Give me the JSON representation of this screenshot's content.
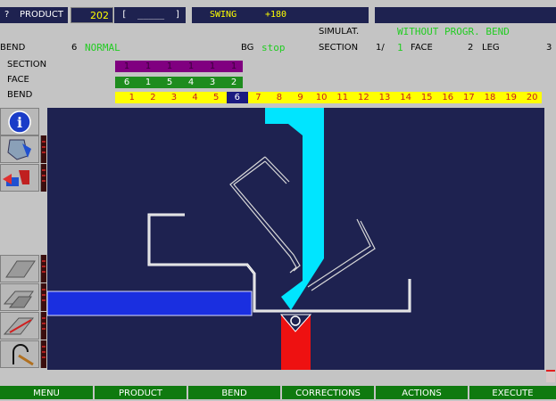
{
  "topbar": {
    "question": "?",
    "product_label": "PRODUCT",
    "product_number": "202",
    "product_name_field": "[  _____  ]",
    "swing_label": "SWING",
    "swing_value": "+180"
  },
  "status": {
    "simulat_label": "SIMULAT.",
    "mode_text": "WITHOUT PROGR. BEND",
    "bend_label": "BEND",
    "bend_number": "6",
    "bend_type": "NORMAL",
    "bg_label": "BG",
    "bg_value": "stop",
    "section_label": "SECTION",
    "section_value": "1/",
    "section_face_num": "1",
    "face_label": "FACE",
    "face_value": "2",
    "leg_label": "LEG",
    "leg_value": "3"
  },
  "strips": {
    "section_label": "SECTION",
    "face_label": "FACE",
    "bend_label": "BEND",
    "section_values": [
      "1",
      "1",
      "1",
      "1",
      "1",
      "1"
    ],
    "face_values": [
      "6",
      "1",
      "5",
      "4",
      "3",
      "2"
    ],
    "bend_values": [
      "1",
      "2",
      "3",
      "4",
      "5",
      "6",
      "7",
      "8",
      "9",
      "10",
      "11",
      "12",
      "13",
      "14",
      "15",
      "16",
      "17",
      "18",
      "19",
      "20"
    ],
    "current_bend_index": 5
  },
  "toolbar": {
    "info_icon": "info-icon",
    "tools": [
      "punch-tool-icon",
      "tool-change-icon",
      "press-tool-icon",
      "bending-tool-icon",
      "angle-measure-icon"
    ]
  },
  "menu": {
    "items": [
      "MENU",
      "PRODUCT",
      "BEND",
      "CORRECTIONS",
      "ACTIONS",
      "EXECUTE"
    ]
  },
  "colors": {
    "background": "#c4c4c4",
    "panel": "#1e2250",
    "section_strip": "#800080",
    "face_strip": "#1e8c1e",
    "bend_strip": "#ffff00",
    "punch": "#00e5ff",
    "die": "#ee1111",
    "backgauge": "#1a2fe0",
    "menu": "#0f7a0f"
  }
}
